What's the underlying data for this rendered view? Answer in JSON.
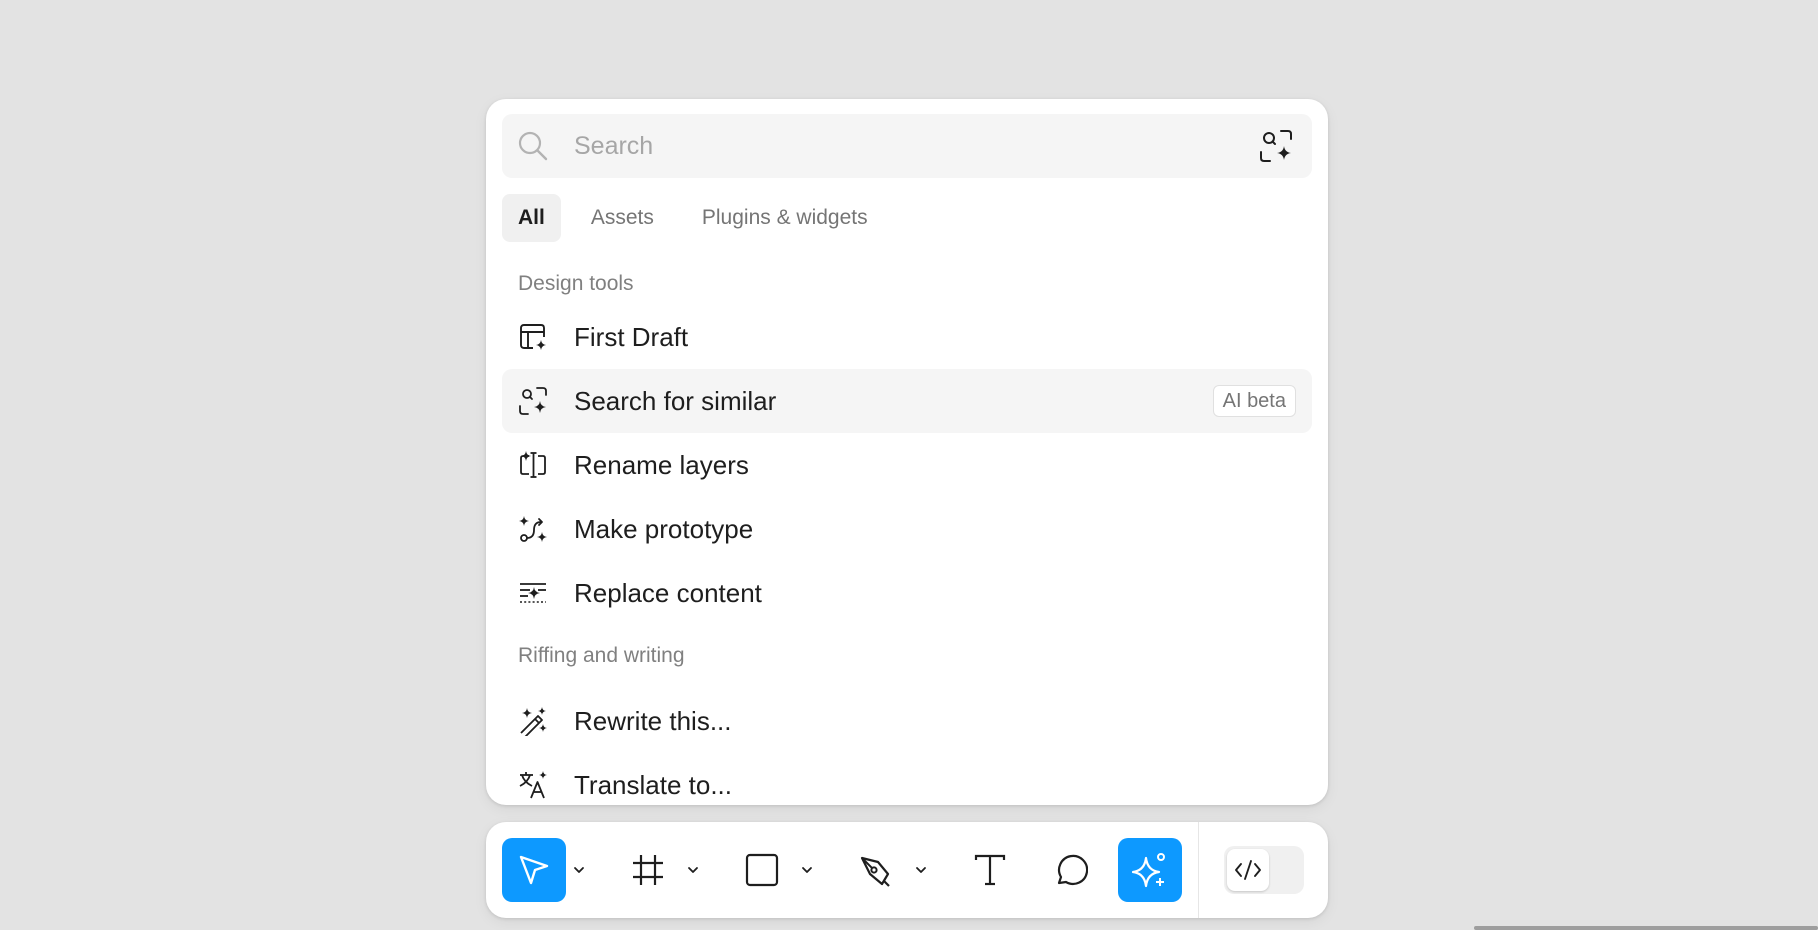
{
  "search": {
    "placeholder": "Search",
    "value": ""
  },
  "tabs": [
    {
      "label": "All",
      "active": true
    },
    {
      "label": "Assets",
      "active": false
    },
    {
      "label": "Plugins & widgets",
      "active": false
    }
  ],
  "sections": [
    {
      "header": "Design tools",
      "items": [
        {
          "label": "First Draft",
          "icon": "first-draft-icon"
        },
        {
          "label": "Search for similar",
          "icon": "search-similar-icon",
          "badge": "AI beta"
        },
        {
          "label": "Rename layers",
          "icon": "rename-layers-icon"
        },
        {
          "label": "Make prototype",
          "icon": "make-prototype-icon"
        },
        {
          "label": "Replace content",
          "icon": "replace-content-icon"
        }
      ]
    },
    {
      "header": "Riffing and writing",
      "items": [
        {
          "label": "Rewrite this...",
          "icon": "rewrite-wand-icon"
        },
        {
          "label": "Translate to...",
          "icon": "translate-icon"
        }
      ]
    }
  ],
  "toolbar": {
    "tools": [
      {
        "name": "move",
        "icon": "cursor-icon",
        "active": true,
        "has_menu": true
      },
      {
        "name": "frame",
        "icon": "frame-icon",
        "active": false,
        "has_menu": true
      },
      {
        "name": "shape",
        "icon": "rectangle-icon",
        "active": false,
        "has_menu": true
      },
      {
        "name": "pen",
        "icon": "pen-icon",
        "active": false,
        "has_menu": true
      },
      {
        "name": "text",
        "icon": "text-icon",
        "active": false,
        "has_menu": false
      },
      {
        "name": "comment",
        "icon": "comment-icon",
        "active": false,
        "has_menu": false
      },
      {
        "name": "actions",
        "icon": "ai-sparkle-icon",
        "active": true,
        "has_menu": false
      }
    ],
    "dev_mode_icon": "code-icon"
  },
  "colors": {
    "accent": "#0d99ff",
    "background": "#e3e3e3",
    "panel": "#ffffff",
    "hover_row": "#f5f5f5",
    "muted_text": "#808080",
    "text": "#1e1e1e"
  }
}
